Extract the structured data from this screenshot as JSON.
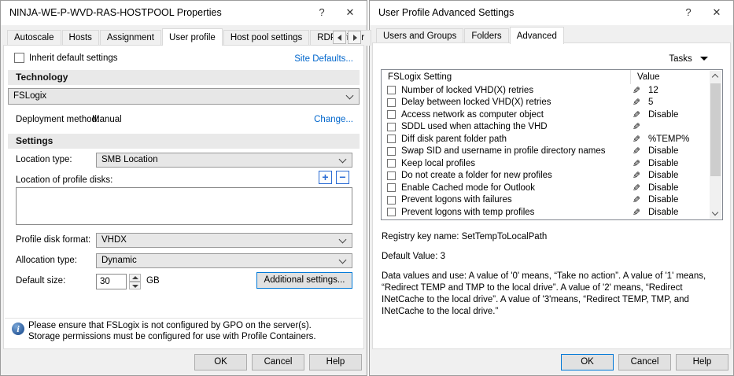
{
  "left": {
    "title": "NINJA-WE-P-WVD-RAS-HOSTPOOL Properties",
    "help_glyph": "?",
    "close_glyph": "✕",
    "tabs": [
      "Autoscale",
      "Hosts",
      "Assignment",
      "User profile",
      "Host pool settings",
      "RDP printer"
    ],
    "selected_tab": "User profile",
    "inherit_label": "Inherit default settings",
    "site_defaults_link": "Site Defaults...",
    "technology_header": "Technology",
    "technology_value": "FSLogix",
    "deployment_label": "Deployment method:",
    "deployment_value": "Manual",
    "change_link": "Change...",
    "settings_header": "Settings",
    "location_type_label": "Location type:",
    "location_type_value": "SMB Location",
    "location_disks_label": "Location of profile disks:",
    "add_glyph": "+",
    "remove_glyph": "−",
    "profile_disk_format_label": "Profile disk format:",
    "profile_disk_format_value": "VHDX",
    "allocation_type_label": "Allocation type:",
    "allocation_type_value": "Dynamic",
    "default_size_label": "Default size:",
    "default_size_value": "30",
    "default_size_unit": "GB",
    "additional_settings_button": "Additional settings...",
    "info_glyph": "i",
    "notice_line1": "Please ensure that FSLogix is not configured by GPO on the server(s).",
    "notice_line2": "Storage permissions must be configured for use with Profile Containers.",
    "ok_button": "OK",
    "cancel_button": "Cancel",
    "help_button": "Help"
  },
  "right": {
    "title": "User Profile Advanced Settings",
    "help_glyph": "?",
    "close_glyph": "✕",
    "tabs": [
      "Users and Groups",
      "Folders",
      "Advanced"
    ],
    "selected_tab": "Advanced",
    "tasks_label": "Tasks",
    "list": {
      "setting_header": "FSLogix Setting",
      "value_header": "Value",
      "pencil_glyph": "✎",
      "rows": [
        {
          "label": "Number of locked VHD(X) retries",
          "value": "12"
        },
        {
          "label": "Delay between locked VHD(X) retries",
          "value": "5"
        },
        {
          "label": "Access network as computer object",
          "value": "Disable"
        },
        {
          "label": "SDDL used when attaching the VHD",
          "value": ""
        },
        {
          "label": "Diff disk parent folder path",
          "value": "%TEMP%"
        },
        {
          "label": "Swap SID and username in profile directory names",
          "value": "Disable"
        },
        {
          "label": "Keep local profiles",
          "value": "Disable"
        },
        {
          "label": "Do not create a folder for new profiles",
          "value": "Disable"
        },
        {
          "label": "Enable Cached mode for Outlook",
          "value": "Disable"
        },
        {
          "label": "Prevent logons with failures",
          "value": "Disable"
        },
        {
          "label": "Prevent logons with temp profiles",
          "value": "Disable"
        }
      ]
    },
    "registry_key_text": "Registry key name: SetTempToLocalPath",
    "default_value_text": "Default Value: 3",
    "description": "Data values and use: A value of '0' means, “Take no action”. A value of '1' means, “Redirect TEMP and TMP to the local drive”. A value of '2' means, “Redirect INetCache to the local drive”. A value of '3'means, “Redirect TEMP, TMP, and INetCache to the local drive.”",
    "ok_button": "OK",
    "cancel_button": "Cancel",
    "help_button": "Help"
  },
  "colors": {
    "link": "#0066cc",
    "default_button_border": "#0078d7",
    "accent_blue_icon": "#2b6cd4",
    "dialog_bg": "#f0f0f0"
  }
}
